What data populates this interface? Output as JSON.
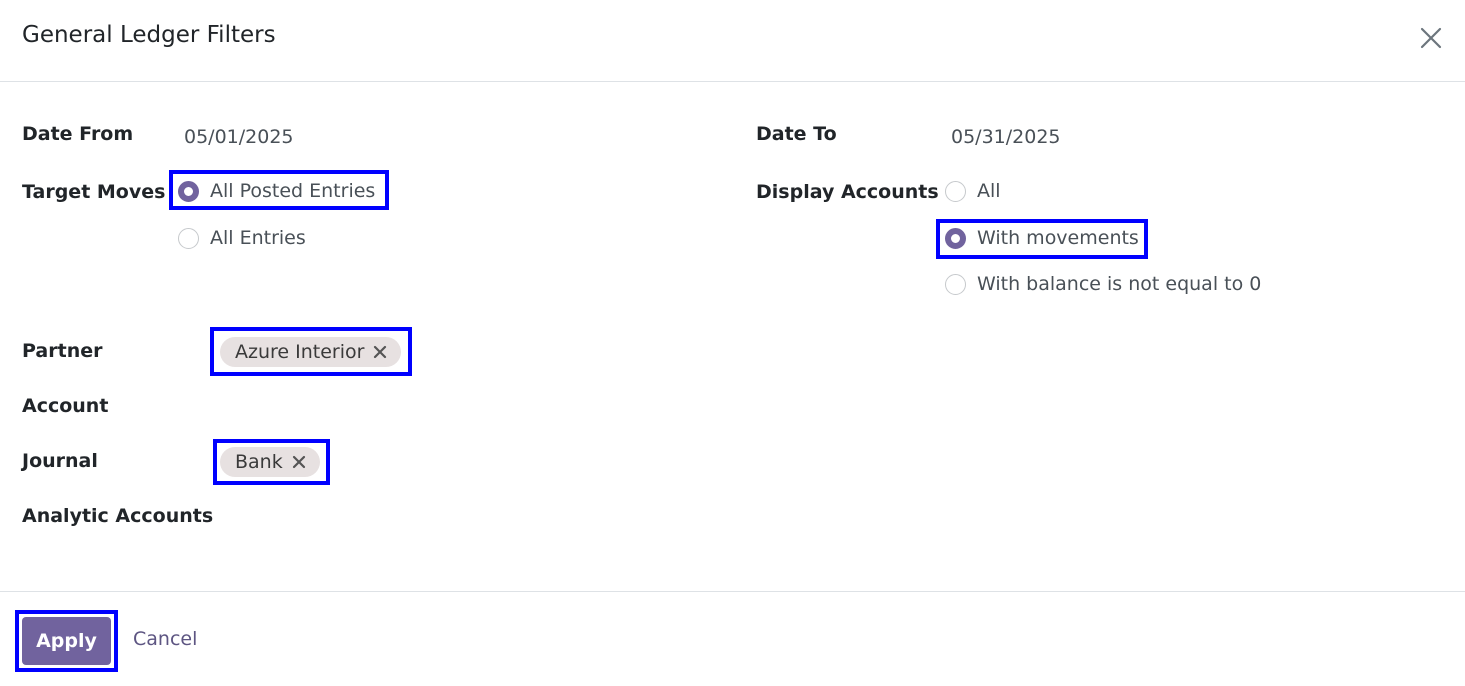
{
  "dialog": {
    "title": "General Ledger Filters"
  },
  "filters": {
    "date_from": {
      "label": "Date From",
      "value": "05/01/2025"
    },
    "date_to": {
      "label": "Date To",
      "value": "05/31/2025"
    },
    "target_moves": {
      "label": "Target Moves",
      "options": [
        {
          "label": "All Posted Entries",
          "checked": true
        },
        {
          "label": "All Entries",
          "checked": false
        }
      ]
    },
    "display_accounts": {
      "label": "Display Accounts",
      "options": [
        {
          "label": "All",
          "checked": false
        },
        {
          "label": "With movements",
          "checked": true
        },
        {
          "label": "With balance is not equal to 0",
          "checked": false
        }
      ]
    },
    "partner": {
      "label": "Partner",
      "tags": [
        "Azure Interior"
      ]
    },
    "account": {
      "label": "Account",
      "tags": []
    },
    "journal": {
      "label": "Journal",
      "tags": [
        "Bank"
      ]
    },
    "analytic_accounts": {
      "label": "Analytic Accounts",
      "tags": []
    }
  },
  "footer": {
    "apply_label": "Apply",
    "cancel_label": "Cancel"
  },
  "colors": {
    "accent": "#71639e",
    "highlight": "#0000ff",
    "tag_bg": "#e7e1e1"
  },
  "icons": {
    "close": "close-icon",
    "tag_remove": "remove-tag-icon"
  }
}
